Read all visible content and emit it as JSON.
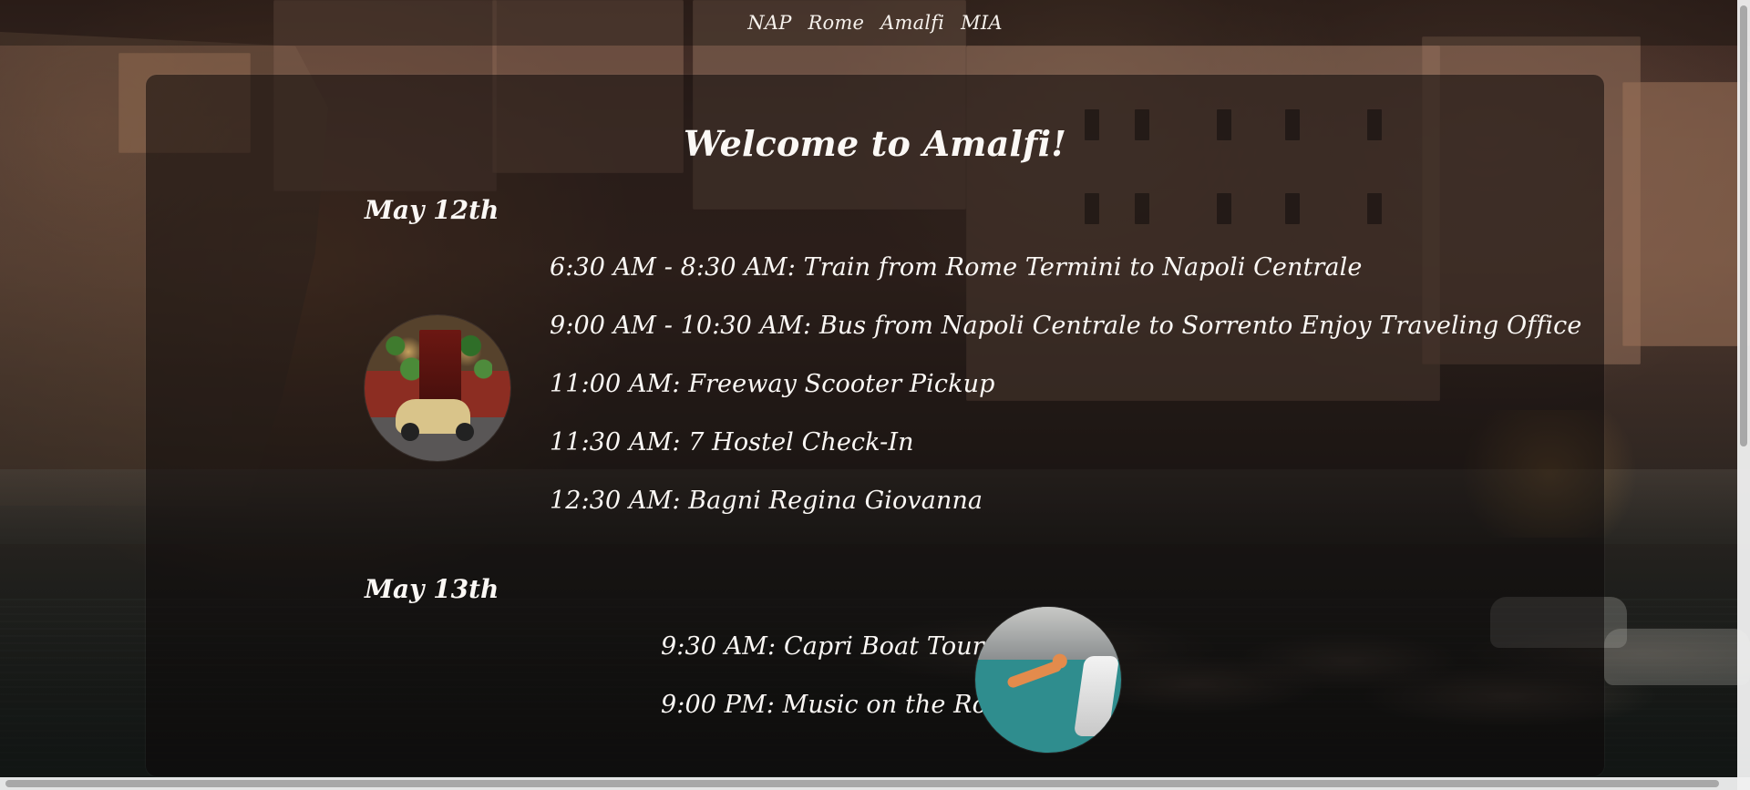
{
  "nav": {
    "items": [
      {
        "label": "NAP"
      },
      {
        "label": "Rome"
      },
      {
        "label": "Amalfi"
      },
      {
        "label": "MIA"
      }
    ]
  },
  "page": {
    "title": "Welcome to Amalfi!"
  },
  "itinerary": {
    "days": [
      {
        "label": "May 12th",
        "events": [
          "6:30 AM - 8:30 AM: Train from Rome Termini to Napoli Centrale",
          "9:00 AM - 10:30 AM: Bus from Napoli Centrale to Sorrento Enjoy Traveling Office",
          "11:00 AM: Freeway Scooter Pickup",
          "11:30 AM: 7 Hostel Check-In",
          "12:30 AM: Bagni Regina Giovanna"
        ]
      },
      {
        "label": "May 13th",
        "events": [
          "9:30 AM: Capri Boat Tour",
          "9:00 PM: Music on the Rocks"
        ]
      }
    ]
  },
  "images": {
    "scooter": "scooter-photo",
    "sea": "diving-photo"
  }
}
